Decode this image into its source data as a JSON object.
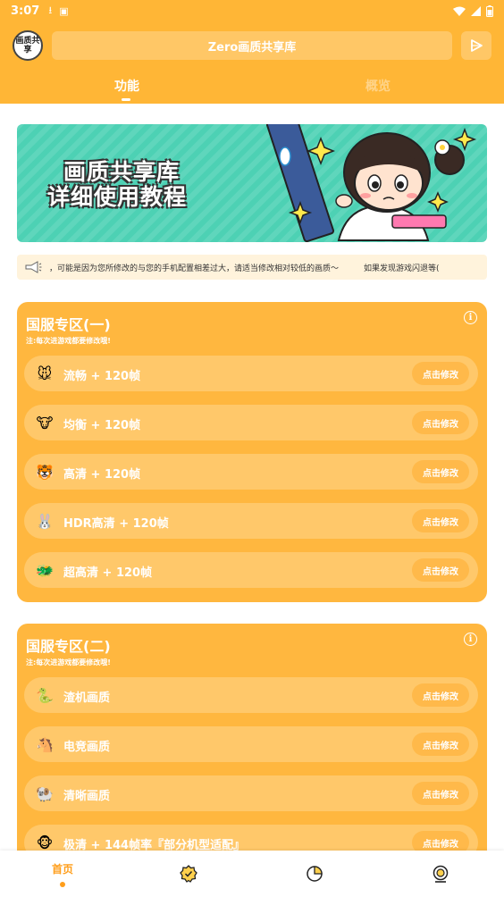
{
  "status": {
    "time": "3:07",
    "icons": [
      "download-icon",
      "a-icon"
    ]
  },
  "header": {
    "logo_text": "画质共享",
    "title": "Zero画质共享库",
    "tabs": [
      {
        "label": "功能"
      },
      {
        "label": "概览"
      }
    ]
  },
  "banner": {
    "line1": "画质共享库",
    "line2": "详细使用教程"
  },
  "notice": {
    "text": "，可能是因为您所修改的与您的手机配置相差过大，请适当修改相对较低的画质～",
    "text2": "如果发现游戏闪退等("
  },
  "sections": [
    {
      "title": "国服专区(一)",
      "note": "注:每次进游戏都要修改哦!",
      "items": [
        {
          "label": "流畅 + 120帧",
          "button": "点击修改",
          "icon": "mouse-icon",
          "glyph": "🐭"
        },
        {
          "label": "均衡 + 120帧",
          "button": "点击修改",
          "icon": "cow-icon",
          "glyph": "🐮"
        },
        {
          "label": "高清 + 120帧",
          "button": "点击修改",
          "icon": "tiger-icon",
          "glyph": "🐯"
        },
        {
          "label": "HDR高清 + 120帧",
          "button": "点击修改",
          "icon": "rabbit-icon",
          "glyph": "🐰"
        },
        {
          "label": "超高清 + 120帧",
          "button": "点击修改",
          "icon": "dragon-icon",
          "glyph": "🐲"
        }
      ]
    },
    {
      "title": "国服专区(二)",
      "note": "注:每次进游戏都要修改哦!",
      "items": [
        {
          "label": "渣机画质",
          "button": "点击修改",
          "icon": "snake-icon",
          "glyph": "🐍"
        },
        {
          "label": "电竞画质",
          "button": "点击修改",
          "icon": "horse-icon",
          "glyph": "🐴"
        },
        {
          "label": "清晰画质",
          "button": "点击修改",
          "icon": "sheep-icon",
          "glyph": "🐏"
        },
        {
          "label": "极清 + 144帧率『部分机型适配』",
          "button": "点击修改",
          "icon": "monkey-icon",
          "glyph": "🐵"
        }
      ]
    }
  ],
  "bottom_nav": {
    "home_label": "首页",
    "items": [
      "home",
      "badge-icon",
      "pie-chart-icon",
      "profile-icon"
    ]
  },
  "colors": {
    "accent": "#FFB636",
    "card": "#FFB73F",
    "row": "#FFC86A",
    "nav_active": "#FF9E1B"
  }
}
